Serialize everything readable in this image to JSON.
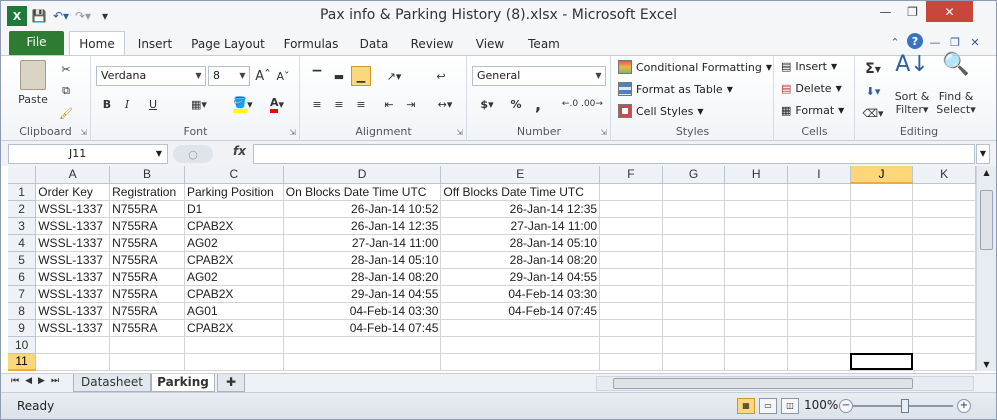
{
  "window": {
    "title": "Pax info & Parking History (8).xlsx  -  Microsoft Excel"
  },
  "ribbon_tabs": {
    "file": "File",
    "home": "Home",
    "insert": "Insert",
    "page_layout": "Page Layout",
    "formulas": "Formulas",
    "data": "Data",
    "review": "Review",
    "view": "View",
    "team": "Team"
  },
  "clipboard": {
    "paste": "Paste",
    "label": "Clipboard"
  },
  "font": {
    "name": "Verdana",
    "size": "8",
    "bold": "B",
    "italic": "I",
    "underline": "U",
    "label": "Font",
    "fill_color": "#ffff00",
    "font_color": "#ff0000"
  },
  "alignment": {
    "label": "Alignment"
  },
  "number": {
    "format": "General",
    "currency": "$",
    "percent": "%",
    "comma": ",",
    "label": "Number"
  },
  "styles": {
    "conditional": "Conditional Formatting",
    "format_table": "Format as Table",
    "cell_styles": "Cell Styles",
    "label": "Styles"
  },
  "cells": {
    "insert": "Insert",
    "delete": "Delete",
    "format": "Format",
    "label": "Cells"
  },
  "editing": {
    "sum": "Σ",
    "sort_filter_1": "Sort &",
    "sort_filter_2": "Filter",
    "find_select_1": "Find &",
    "find_select_2": "Select",
    "label": "Editing"
  },
  "formula_bar": {
    "name_box": "J11",
    "fx": "fx",
    "value": ""
  },
  "columns": [
    "A",
    "B",
    "C",
    "D",
    "E",
    "F",
    "G",
    "H",
    "I",
    "J",
    "K"
  ],
  "rows": [
    {
      "n": "1",
      "cells": [
        "Order Key",
        "Registration",
        "Parking Position",
        "On Blocks Date Time UTC",
        "Off Blocks Date Time UTC",
        "",
        "",
        "",
        "",
        "",
        ""
      ]
    },
    {
      "n": "2",
      "cells": [
        "WSSL-1337",
        "N755RA",
        "D1",
        "26-Jan-14 10:52",
        "26-Jan-14 12:35",
        "",
        "",
        "",
        "",
        "",
        ""
      ]
    },
    {
      "n": "3",
      "cells": [
        "WSSL-1337",
        "N755RA",
        "CPAB2X",
        "26-Jan-14 12:35",
        "27-Jan-14 11:00",
        "",
        "",
        "",
        "",
        "",
        ""
      ]
    },
    {
      "n": "4",
      "cells": [
        "WSSL-1337",
        "N755RA",
        "AG02",
        "27-Jan-14 11:00",
        "28-Jan-14 05:10",
        "",
        "",
        "",
        "",
        "",
        ""
      ]
    },
    {
      "n": "5",
      "cells": [
        "WSSL-1337",
        "N755RA",
        "CPAB2X",
        "28-Jan-14 05:10",
        "28-Jan-14 08:20",
        "",
        "",
        "",
        "",
        "",
        ""
      ]
    },
    {
      "n": "6",
      "cells": [
        "WSSL-1337",
        "N755RA",
        "AG02",
        "28-Jan-14 08:20",
        "29-Jan-14 04:55",
        "",
        "",
        "",
        "",
        "",
        ""
      ]
    },
    {
      "n": "7",
      "cells": [
        "WSSL-1337",
        "N755RA",
        "CPAB2X",
        "29-Jan-14 04:55",
        "04-Feb-14 03:30",
        "",
        "",
        "",
        "",
        "",
        ""
      ]
    },
    {
      "n": "8",
      "cells": [
        "WSSL-1337",
        "N755RA",
        "AG01",
        "04-Feb-14 03:30",
        "04-Feb-14 07:45",
        "",
        "",
        "",
        "",
        "",
        ""
      ]
    },
    {
      "n": "9",
      "cells": [
        "WSSL-1337",
        "N755RA",
        "CPAB2X",
        "04-Feb-14 07:45",
        "",
        "",
        "",
        "",
        "",
        "",
        ""
      ]
    },
    {
      "n": "10",
      "cells": [
        "",
        "",
        "",
        "",
        "",
        "",
        "",
        "",
        "",
        "",
        ""
      ]
    },
    {
      "n": "11",
      "cells": [
        "",
        "",
        "",
        "",
        "",
        "",
        "",
        "",
        "",
        "",
        ""
      ]
    }
  ],
  "selected": {
    "col": "J",
    "row": "11"
  },
  "sheets": {
    "datasheet": "Datasheet",
    "parking": "Parking"
  },
  "status": {
    "ready": "Ready",
    "zoom": "100%"
  }
}
